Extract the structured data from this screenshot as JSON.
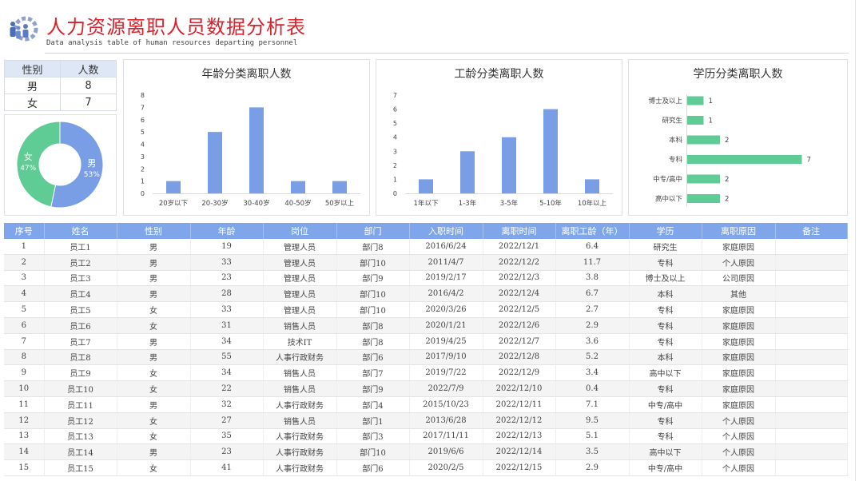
{
  "header": {
    "title": "人力资源离职人员数据分析表",
    "subtitle": "Data analysis table of human resources departing personnel"
  },
  "gender_summary": {
    "headers": [
      "性别",
      "人数"
    ],
    "rows": [
      [
        "男",
        "8"
      ],
      [
        "女",
        "7"
      ]
    ]
  },
  "colors": {
    "blue": "#7a9ee6",
    "green": "#5fcb95",
    "header_blue": "#7fa6ea",
    "title_red": "#d9232d"
  },
  "chart_data": [
    {
      "type": "pie",
      "donut": true,
      "slices": [
        {
          "name": "男",
          "value": 8,
          "percent": "53%"
        },
        {
          "name": "女",
          "value": 7,
          "percent": "47%"
        }
      ]
    },
    {
      "type": "bar",
      "title": "年龄分类离职人数",
      "categories": [
        "20岁以下",
        "20-30岁",
        "30-40岁",
        "40-50岁",
        "50岁以上"
      ],
      "values": [
        1,
        5,
        7,
        1,
        1
      ],
      "ylim": [
        0,
        8
      ],
      "ticks": [
        "0",
        "1",
        "2",
        "3",
        "4",
        "5",
        "6",
        "7",
        "8"
      ]
    },
    {
      "type": "bar",
      "title": "工龄分类离职人数",
      "categories": [
        "1年以下",
        "1-3年",
        "3-5年",
        "5-10年",
        "10年以上"
      ],
      "values": [
        1,
        3,
        4,
        6,
        1
      ],
      "ylim": [
        0,
        7
      ],
      "ticks": [
        "0",
        "1",
        "2",
        "3",
        "4",
        "5",
        "6",
        "7"
      ]
    },
    {
      "type": "bar",
      "orientation": "horizontal",
      "title": "学历分类离职人数",
      "categories": [
        "博士及以上",
        "研究生",
        "本科",
        "专科",
        "中专/高中",
        "高中以下"
      ],
      "values": [
        1,
        1,
        2,
        7,
        2,
        2
      ]
    }
  ],
  "table": {
    "columns": [
      "序号",
      "姓名",
      "性别",
      "年龄",
      "岗位",
      "部门",
      "入职时间",
      "离职时间",
      "离职工龄（年）",
      "学历",
      "离职原因",
      "备注"
    ],
    "rows": [
      [
        "1",
        "员工1",
        "男",
        "19",
        "管理人员",
        "部门8",
        "2016/6/24",
        "2022/12/1",
        "6.4",
        "研究生",
        "家庭原因",
        ""
      ],
      [
        "2",
        "员工2",
        "男",
        "33",
        "管理人员",
        "部门10",
        "2011/4/7",
        "2022/12/2",
        "11.7",
        "专科",
        "个人原因",
        ""
      ],
      [
        "3",
        "员工3",
        "男",
        "23",
        "管理人员",
        "部门9",
        "2019/2/17",
        "2022/12/3",
        "3.8",
        "博士及以上",
        "公司原因",
        ""
      ],
      [
        "4",
        "员工4",
        "男",
        "28",
        "管理人员",
        "部门10",
        "2016/4/2",
        "2022/12/4",
        "6.7",
        "本科",
        "其他",
        ""
      ],
      [
        "5",
        "员工5",
        "女",
        "33",
        "管理人员",
        "部门10",
        "2020/3/26",
        "2022/12/5",
        "2.7",
        "专科",
        "家庭原因",
        ""
      ],
      [
        "6",
        "员工6",
        "女",
        "31",
        "销售人员",
        "部门8",
        "2020/1/21",
        "2022/12/6",
        "2.9",
        "专科",
        "家庭原因",
        ""
      ],
      [
        "7",
        "员工7",
        "男",
        "34",
        "技术IT",
        "部门8",
        "2019/4/25",
        "2022/12/7",
        "3.6",
        "专科",
        "家庭原因",
        ""
      ],
      [
        "8",
        "员工8",
        "男",
        "55",
        "人事行政财务",
        "部门6",
        "2017/9/10",
        "2022/12/8",
        "5.2",
        "本科",
        "家庭原因",
        ""
      ],
      [
        "9",
        "员工9",
        "女",
        "34",
        "销售人员",
        "部门7",
        "2019/7/22",
        "2022/12/9",
        "3.4",
        "高中以下",
        "家庭原因",
        ""
      ],
      [
        "10",
        "员工10",
        "女",
        "22",
        "销售人员",
        "部门9",
        "2022/7/9",
        "2022/12/10",
        "0.4",
        "专科",
        "家庭原因",
        ""
      ],
      [
        "11",
        "员工11",
        "男",
        "32",
        "人事行政财务",
        "部门4",
        "2015/10/23",
        "2022/12/11",
        "7.1",
        "中专/高中",
        "家庭原因",
        ""
      ],
      [
        "12",
        "员工12",
        "女",
        "27",
        "销售人员",
        "部门1",
        "2013/6/28",
        "2022/12/12",
        "9.5",
        "专科",
        "个人原因",
        ""
      ],
      [
        "13",
        "员工13",
        "女",
        "35",
        "人事行政财务",
        "部门3",
        "2017/11/11",
        "2022/12/13",
        "5.1",
        "专科",
        "个人原因",
        ""
      ],
      [
        "14",
        "员工14",
        "男",
        "23",
        "人事行政财务",
        "部门10",
        "2019/6/6",
        "2022/12/14",
        "3.5",
        "高中以下",
        "个人原因",
        ""
      ],
      [
        "15",
        "员工15",
        "女",
        "41",
        "人事行政财务",
        "部门6",
        "2020/2/5",
        "2022/12/15",
        "2.9",
        "中专/高中",
        "个人原因",
        ""
      ]
    ]
  }
}
